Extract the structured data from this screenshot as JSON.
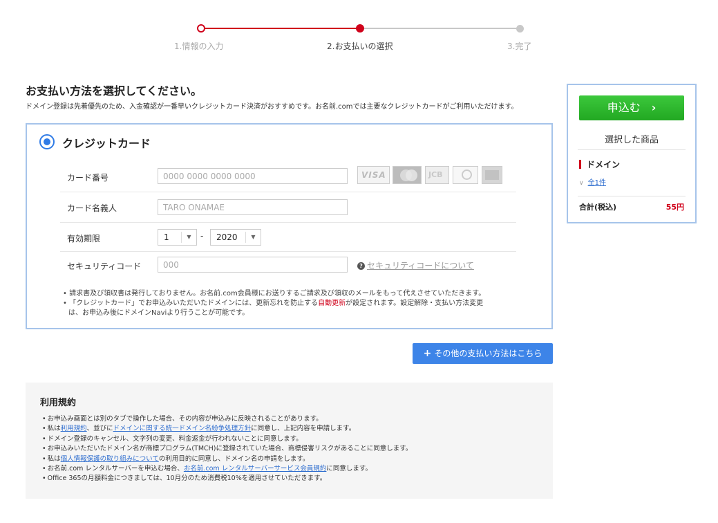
{
  "stepper": {
    "steps": [
      {
        "label": "1.情報の入力"
      },
      {
        "label": "2.お支払いの選択"
      },
      {
        "label": "3.完了"
      }
    ]
  },
  "header": {
    "title": "お支払い方法を選択してください。",
    "description": "ドメイン登録は先着優先のため、入金確認が一番早いクレジットカード決済がおすすめです。お名前.comでは主要なクレジットカードがご利用いただけます。"
  },
  "credit_card": {
    "option_label": "クレジットカード",
    "card_number": {
      "label": "カード番号",
      "placeholder": "0000 0000 0000 0000"
    },
    "card_brands": [
      "VISA",
      "MasterCard",
      "JCB",
      "Diners Club",
      "AMEX"
    ],
    "card_brand_texts": {
      "visa": "VISA",
      "jcb": "JCB"
    },
    "holder": {
      "label": "カード名義人",
      "placeholder": "TARO ONAMAE"
    },
    "expiry": {
      "label": "有効期限",
      "month": "1",
      "separator": "-",
      "year": "2020",
      "arrow": "▼"
    },
    "security": {
      "label": "セキュリティコード",
      "placeholder": "000",
      "help_link": "セキュリティコードについて",
      "help_icon": "?"
    },
    "notes": {
      "line1": "• 請求書及び領収書は発行しておりません。お名前.com会員様にお送りするご請求及び領収のメールをもって代えさせていただきます。",
      "line2_pre": "• 「クレジットカード」でお申込みいただいたドメインには、更新忘れを防止する",
      "line2_red": "自動更新",
      "line2_post": "が設定されます。設定解除・支払い方法変更",
      "line3": "は、お申込み後にドメインNaviより行うことが可能です。"
    }
  },
  "other_payment": {
    "icon": "+",
    "label": "その他の支払い方法はこちら"
  },
  "terms": {
    "title": "利用規約",
    "items": {
      "t1": "お申込み画面とは別のタブで操作した場合、その内容が申込みに反映されることがあります。",
      "t2_a": "私は",
      "t2_link1": "利用規約",
      "t2_b": "、並びに",
      "t2_link2": "ドメインに関する統一ドメイン名紛争処理方針",
      "t2_c": "に同意し、上記内容を申請します。",
      "t3": "ドメイン登録のキャンセル、文字列の変更、料金返金が行われないことに同意します。",
      "t4": "お申込みいただいたドメイン名が商標プログラム(TMCH)に登録されていた場合、商標侵害リスクがあることに同意します。",
      "t5_a": "私は",
      "t5_link": "個人情報保護の取り組みについて",
      "t5_b": "の利用目的に同意し、ドメイン名の申請をします。",
      "t6_a": "お名前.com レンタルサーバーを申込む場合、",
      "t6_link": "お名前.com レンタルサーバーサービス会員規約",
      "t6_b": "に同意します。",
      "t7": "Office 365の月額料金につきましては、10月分のため消費税10%を適用させていただきます。"
    }
  },
  "summary": {
    "apply_label": "申込む",
    "apply_chevron": "›",
    "selected_title": "選択した商品",
    "domain_label": "ドメイン",
    "toggle_icon": "∨",
    "all_link": "全1件",
    "total_label": "合計(税込)",
    "total_value": "55円"
  },
  "colors": {
    "accent_red": "#d0021b",
    "border_blue": "#a6c4ea",
    "button_blue": "#3d84e8",
    "button_green": "#2eb82e"
  }
}
